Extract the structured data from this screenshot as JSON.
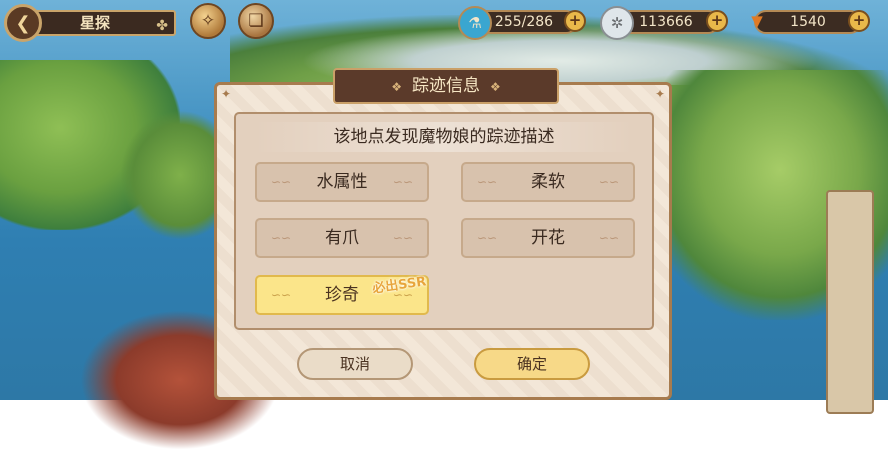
{
  "header": {
    "title": "星探"
  },
  "resources": [
    {
      "name": "stamina",
      "icon": "flask-icon",
      "value": "255/286"
    },
    {
      "name": "coins",
      "icon": "gear-coin-icon",
      "value": "113666"
    },
    {
      "name": "carrot",
      "icon": "carrot-icon",
      "value": "1540"
    }
  ],
  "dialog": {
    "title": "踪迹信息",
    "description": "该地点发现魔物娘的踪迹描述",
    "options": [
      {
        "label": "水属性"
      },
      {
        "label": "柔软"
      },
      {
        "label": "有爪"
      },
      {
        "label": "开花"
      },
      {
        "label": "珍奇"
      }
    ],
    "badge": "必出SSR",
    "cancel_label": "取消",
    "confirm_label": "确定"
  }
}
